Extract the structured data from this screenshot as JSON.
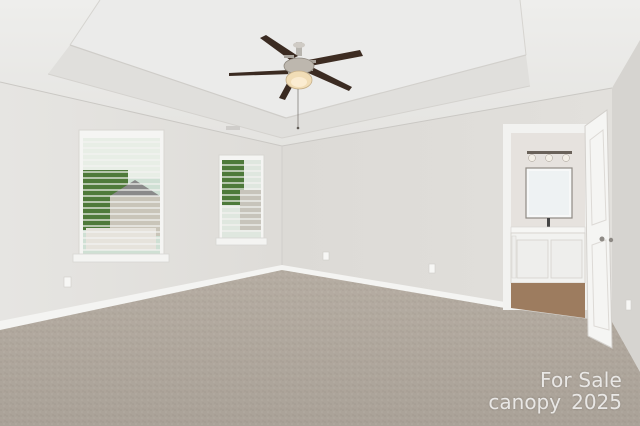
{
  "photo": {
    "watermark": {
      "line1": "For Sale",
      "brand": "canopy",
      "year": "2025"
    }
  }
}
